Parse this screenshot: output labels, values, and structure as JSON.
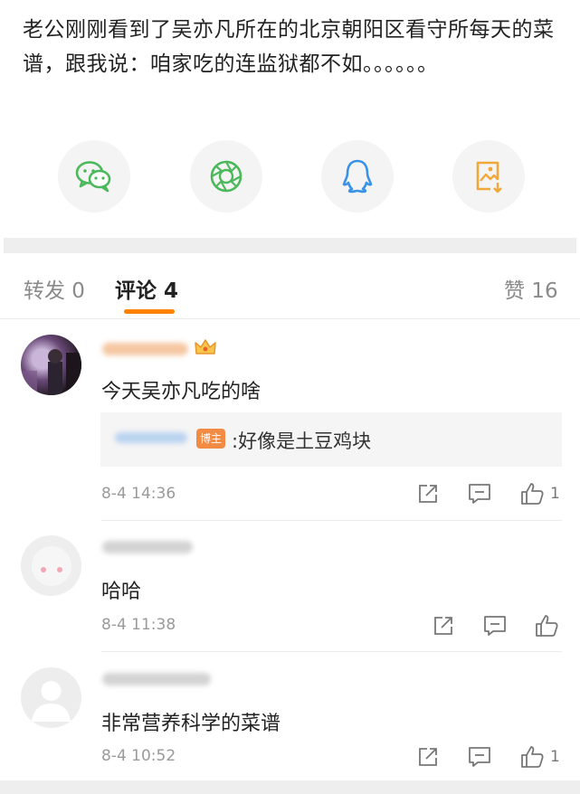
{
  "post": {
    "text": "老公刚刚看到了吴亦凡所在的北京朝阳区看守所每天的菜谱，跟我说：咱家吃的连监狱都不如。。。。。。"
  },
  "share_buttons": [
    {
      "icon": "wechat-icon",
      "color": "#4cb85c"
    },
    {
      "icon": "moments-icon",
      "color": "#4cb85c"
    },
    {
      "icon": "qq-icon",
      "color": "#3a92e8"
    },
    {
      "icon": "save-image-icon",
      "color": "#f0a83a"
    }
  ],
  "tabs": {
    "repost": "转发 0",
    "comments": "评论 4",
    "likes": "赞 16"
  },
  "comments": [
    {
      "text": "今天吴亦凡吃的啥",
      "reply": {
        "badge": "博主",
        "text": ":好像是土豆鸡块"
      },
      "time": "8-4 14:36",
      "likes": "1"
    },
    {
      "text": "哈哈",
      "time": "8-4 11:38",
      "likes": ""
    },
    {
      "text": "非常营养科学的菜谱",
      "time": "8-4 10:52",
      "likes": "1"
    }
  ],
  "colors": {
    "accent": "#ff8200",
    "muted": "#9a9a9a",
    "text": "#222222"
  }
}
